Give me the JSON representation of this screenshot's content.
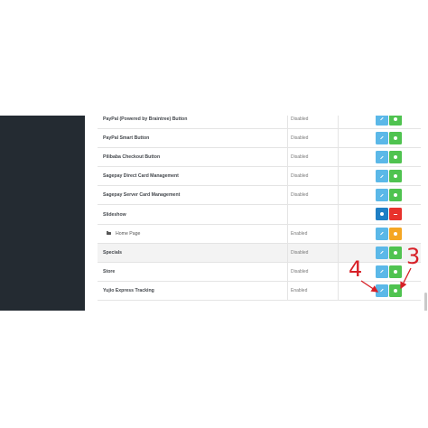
{
  "extensions": [
    {
      "name": "PayPal (Powered by Braintree) Button",
      "status": "Disabled",
      "buttons": [
        "edit",
        "install"
      ]
    },
    {
      "name": "PayPal Smart Button",
      "status": "Disabled",
      "buttons": [
        "edit",
        "install"
      ]
    },
    {
      "name": "Pilibaba Checkout Button",
      "status": "Disabled",
      "buttons": [
        "edit",
        "install"
      ]
    },
    {
      "name": "Sagepay Direct Card Management",
      "status": "Disabled",
      "buttons": [
        "edit",
        "install"
      ]
    },
    {
      "name": "Sagepay Server Card Management",
      "status": "Disabled",
      "buttons": [
        "edit",
        "install"
      ]
    },
    {
      "name": "Slideshow",
      "status": "",
      "buttons": [
        "add",
        "uninstall"
      ]
    },
    {
      "name": "Home Page",
      "status": "Enabled",
      "buttons": [
        "edit",
        "delete"
      ],
      "sub": true
    },
    {
      "name": "Specials",
      "status": "Disabled",
      "buttons": [
        "edit",
        "install"
      ]
    },
    {
      "name": "Store",
      "status": "Disabled",
      "buttons": [
        "edit",
        "install"
      ]
    },
    {
      "name": "Yujio Express Tracking",
      "status": "Enabled",
      "buttons": [
        "edit",
        "install"
      ]
    }
  ],
  "annotations": {
    "left_number": "4",
    "right_number": "3",
    "color": "#d71f26"
  },
  "colors": {
    "sidebar": "#242b32",
    "edit": "#5bb8e8",
    "install": "#4fc350",
    "add": "#1f7fc5",
    "uninstall": "#e8322c",
    "delete": "#f5a623"
  }
}
